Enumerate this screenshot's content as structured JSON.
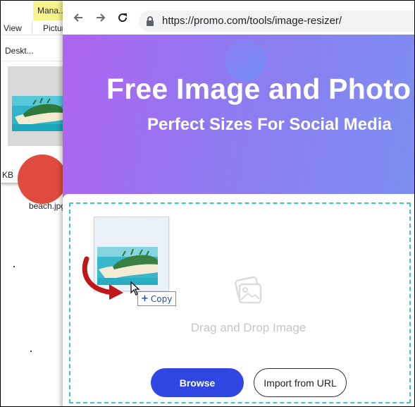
{
  "explorer": {
    "manage_tab": "Mana...",
    "view_tab": "View",
    "picture_tab": "Pictur",
    "address": "Deskt...",
    "file_name": "beach.jpg",
    "size_fragment": "KB"
  },
  "browser": {
    "url": "https://promo.com/tools/image-resizer/"
  },
  "hero": {
    "title": "Free Image and Photo",
    "subtitle": "Perfect Sizes For Social Media"
  },
  "dropzone": {
    "hint": "Drag and Drop Image",
    "browse_label": "Browse",
    "import_label": "Import from URL"
  },
  "drag": {
    "copy_label": "Copy"
  },
  "colors": {
    "hero_gradient_start": "#b064f2",
    "hero_gradient_end": "#7c8ff2",
    "browse_button": "#2f47e0",
    "dropzone_border": "#3ec4cf",
    "manage_tab_bg": "#f7f48d"
  }
}
